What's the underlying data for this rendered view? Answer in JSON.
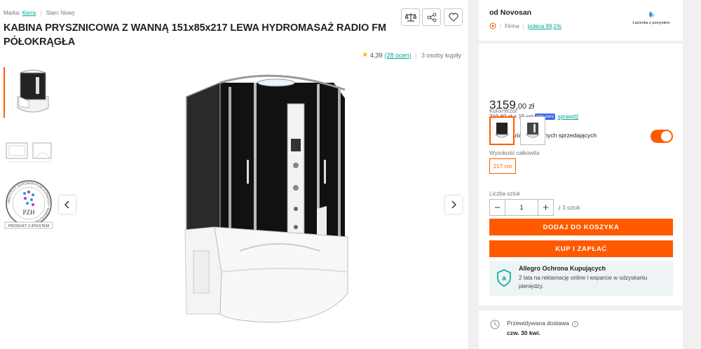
{
  "product": {
    "brand_label": "Marka:",
    "brand_value": "Kerra",
    "condition_label": "Stan:",
    "condition_value": "Nowy",
    "title": "KABINA PRYSZNICOWA Z WANNĄ 151x85x217 LEWA HYDROMASAŻ RADIO FM PÓŁOKRĄGŁA",
    "rating_value": "4,39",
    "rating_count": "(28 ocen)",
    "buyers": "3 osoby kupiły",
    "cert_label": "PRODUKT Z ATESTEM",
    "cert_mark": "PZH",
    "cert_ring_text": "INSTYTUT ZDROWIA PUBLICZNEGO • NARODOWY"
  },
  "seller": {
    "name": "od Novosan",
    "type": "Firma",
    "recommend": "poleca 99,1%",
    "logo_text": "Łazienka z pomysłem"
  },
  "offer": {
    "price_main": "3159",
    "price_cents": ",00 zł",
    "installments_text": "210,60 zł × 15 rat",
    "installments_badge": "raty zero",
    "installments_link": "sprawdź",
    "variants_toggle_label": "Pokaż warianty od innych sprzedających",
    "color_label": "Kolor/Wzór",
    "height_label": "Wysokość całkowita",
    "height_option": "217 cm",
    "qty_label": "Liczba sztuk",
    "qty_minus": "−",
    "qty_value": "1",
    "qty_plus": "+",
    "qty_of": "z 3 sztuk",
    "add_to_cart": "DODAJ DO KOSZYKA",
    "buy_now": "KUP I ZAPŁAĆ",
    "protection_title": "Allegro Ochrona Kupujących",
    "protection_desc": "2 lata na reklamację online i wsparcie w odzyskaniu pieniędzy.",
    "delivery_label": "Przewidywana dostawa",
    "delivery_date": "czw. 30 kwi."
  },
  "colors": {
    "accent": "#ff5a00",
    "link": "#00a790",
    "badge": "#3d67e8"
  }
}
